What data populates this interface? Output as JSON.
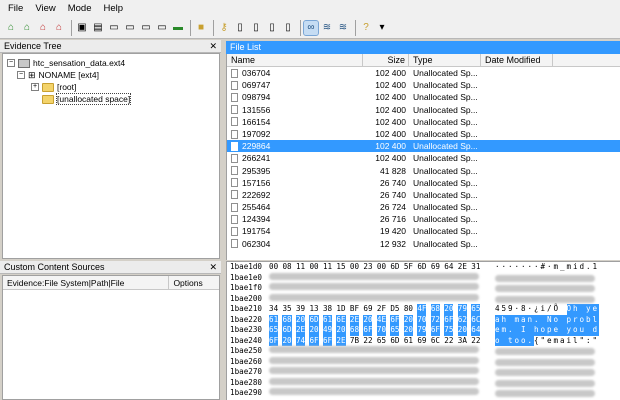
{
  "menu": [
    "File",
    "View",
    "Mode",
    "Help"
  ],
  "panels": {
    "evidence_tree": "Evidence Tree",
    "custom_sources": "Custom Content Sources",
    "file_list": "File List"
  },
  "tree": [
    {
      "label": "htc_sensation_data.ext4",
      "kind": "image"
    },
    {
      "label": "NONAME [ext4]",
      "kind": "volume"
    },
    {
      "label": "[root]",
      "kind": "folder"
    },
    {
      "label": "[unallocated space]",
      "kind": "folder"
    }
  ],
  "ccs_columns": [
    "Evidence:File System|Path|File",
    "Options"
  ],
  "file_columns": [
    "Name",
    "Size",
    "Type",
    "Date Modified"
  ],
  "files": [
    {
      "name": "036704",
      "size": "102 400",
      "type": "Unallocated Sp..."
    },
    {
      "name": "069747",
      "size": "102 400",
      "type": "Unallocated Sp..."
    },
    {
      "name": "098794",
      "size": "102 400",
      "type": "Unallocated Sp..."
    },
    {
      "name": "131556",
      "size": "102 400",
      "type": "Unallocated Sp..."
    },
    {
      "name": "166154",
      "size": "102 400",
      "type": "Unallocated Sp..."
    },
    {
      "name": "197092",
      "size": "102 400",
      "type": "Unallocated Sp..."
    },
    {
      "name": "229864",
      "size": "102 400",
      "type": "Unallocated Sp...",
      "selected": true
    },
    {
      "name": "266241",
      "size": "102 400",
      "type": "Unallocated Sp..."
    },
    {
      "name": "295395",
      "size": "41 828",
      "type": "Unallocated Sp..."
    },
    {
      "name": "157156",
      "size": "26 740",
      "type": "Unallocated Sp..."
    },
    {
      "name": "222692",
      "size": "26 740",
      "type": "Unallocated Sp..."
    },
    {
      "name": "255464",
      "size": "26 724",
      "type": "Unallocated Sp..."
    },
    {
      "name": "124394",
      "size": "26 716",
      "type": "Unallocated Sp..."
    },
    {
      "name": "191754",
      "size": "19 420",
      "type": "Unallocated Sp..."
    },
    {
      "name": "062304",
      "size": "12 932",
      "type": "Unallocated Sp..."
    }
  ],
  "hex_rows": [
    {
      "offset": "1bae1d0",
      "hex": [
        "00",
        "08",
        "11",
        "00",
        "11",
        "15",
        "00",
        "23",
        "00",
        "6D",
        "5F",
        "6D",
        "69",
        "64",
        "2E",
        "31"
      ],
      "ascii": "·······#·m_mid.1"
    },
    {
      "offset": "1bae1e0",
      "blur": true
    },
    {
      "offset": "1bae1f0",
      "blur": true
    },
    {
      "offset": "1bae200",
      "blur": true
    },
    {
      "offset": "1bae210",
      "hex": [
        "34",
        "35",
        "39",
        "13",
        "38",
        "1D",
        "BF",
        "69",
        "2F",
        "D5",
        "80",
        "4F",
        "68",
        "20",
        "79",
        "65"
      ],
      "ascii": "459·8·¿i/Õ Oh ye",
      "sel_from": 11
    },
    {
      "offset": "1bae220",
      "hex": [
        "61",
        "68",
        "20",
        "6D",
        "61",
        "6E",
        "2E",
        "20",
        "4E",
        "6F",
        "20",
        "70",
        "72",
        "6F",
        "62",
        "6C"
      ],
      "ascii": "ah man. No probl",
      "sel_from": 0
    },
    {
      "offset": "1bae230",
      "hex": [
        "65",
        "6D",
        "2E",
        "20",
        "49",
        "20",
        "68",
        "6F",
        "70",
        "65",
        "20",
        "79",
        "6F",
        "75",
        "20",
        "64"
      ],
      "ascii": "em. I hope you d",
      "sel_from": 0
    },
    {
      "offset": "1bae240",
      "hex": [
        "6F",
        "20",
        "74",
        "6F",
        "6F",
        "2E",
        "7B",
        "22",
        "65",
        "6D",
        "61",
        "69",
        "6C",
        "22",
        "3A",
        "22"
      ],
      "ascii": "o too.{\"email\":\"",
      "sel_to": 5
    },
    {
      "offset": "1bae250",
      "blur": true
    },
    {
      "offset": "1bae260",
      "blur": true
    },
    {
      "offset": "1bae270",
      "blur": true
    },
    {
      "offset": "1bae280",
      "blur": true
    },
    {
      "offset": "1bae290",
      "blur": true
    }
  ],
  "colors": {
    "selection": "#3399ff",
    "folder": "#f3d36a"
  }
}
